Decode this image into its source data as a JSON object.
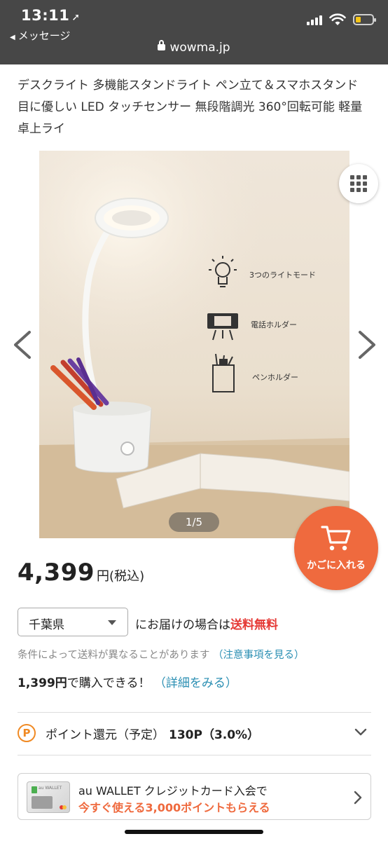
{
  "status_bar": {
    "time": "13:11",
    "back_label": "メッセージ",
    "url": "wowma.jp"
  },
  "product": {
    "title": "デスクライト 多機能スタンドライト ペン立て＆スマホスタンド 目に優しい LED タッチセンサー 無段階調光 360°回転可能 軽量 卓上ライ",
    "image_features": [
      {
        "label": "3つのライトモード",
        "icon": "bulb-icon"
      },
      {
        "label": "電話ホルダー",
        "icon": "phone-holder-icon"
      },
      {
        "label": "ペンホルダー",
        "icon": "pen-holder-icon"
      }
    ],
    "image_pager": "1/5",
    "cart_label": "かごに入れる",
    "price_amount": "4,399",
    "price_unit": "円(税込)"
  },
  "shipping": {
    "prefecture": "千葉県",
    "text_prefix": "にお届けの場合は",
    "free_label": "送料無料",
    "condition_note": "条件によって送料が異なることがあります",
    "condition_link": "（注意事項を見る）",
    "purchase_price": "1,399円",
    "purchase_suffix": "で購入できる！",
    "detail_link": "（詳細をみる）"
  },
  "points": {
    "icon_letter": "P",
    "label": "ポイント還元（予定）",
    "value": "130P（3.0%）"
  },
  "banner": {
    "line1": "au WALLET クレジットカード入会で",
    "line2": "今すぐ使える3,000ポイントもらえる",
    "card_brand": "au WALLET"
  },
  "colors": {
    "header_bg": "#474747",
    "cart_orange": "#ef6a3e",
    "free_red": "#e53935",
    "link_blue": "#2b8fb3",
    "points_orange": "#f08a24"
  }
}
